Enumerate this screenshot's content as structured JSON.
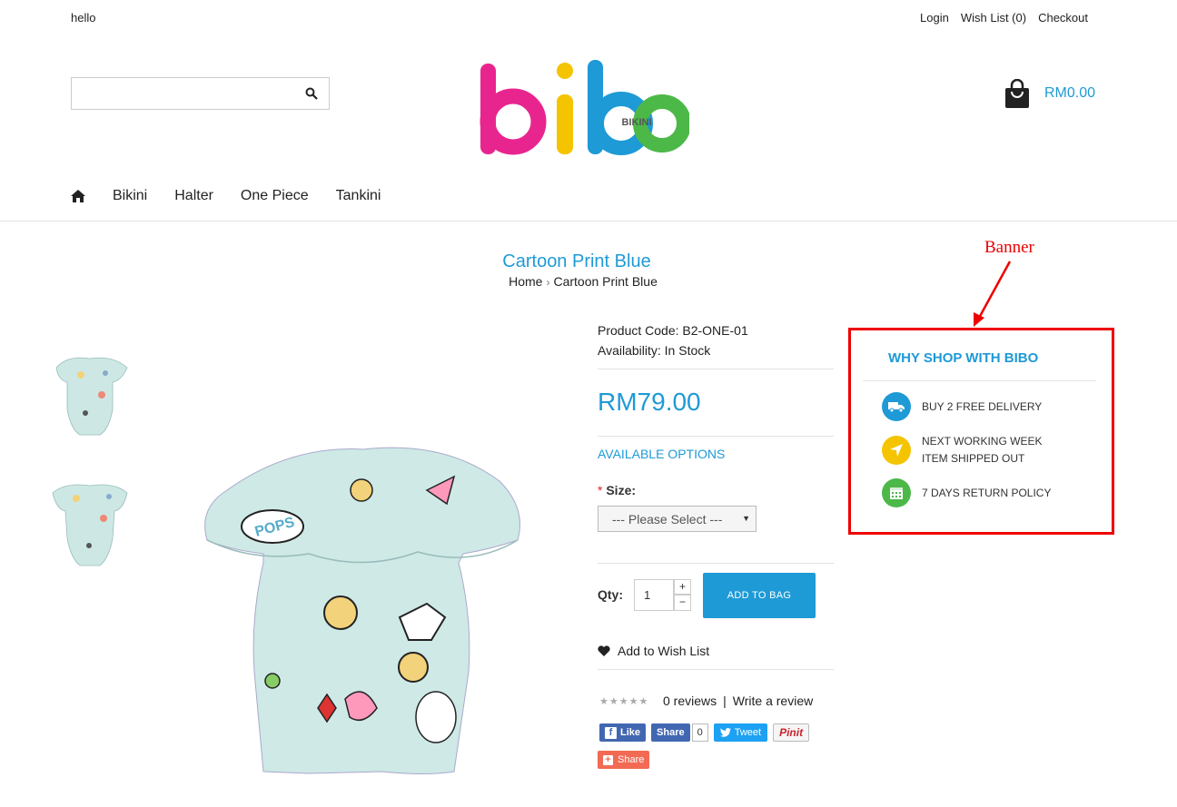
{
  "topbar": {
    "greeting": "hello",
    "links": [
      "Login",
      "Wish List (0)",
      "Checkout"
    ]
  },
  "search": {
    "placeholder": ""
  },
  "logo": {
    "text": "bibo",
    "sub": "BIKINI"
  },
  "cart": {
    "total": "RM0.00"
  },
  "nav": {
    "items": [
      "Bikini",
      "Halter",
      "One Piece",
      "Tankini"
    ]
  },
  "page": {
    "title": "Cartoon Print Blue"
  },
  "breadcrumb": {
    "home": "Home",
    "current": "Cartoon Print Blue"
  },
  "product": {
    "code_label": "Product Code: B2-ONE-01",
    "availability_label": "Availability: In Stock",
    "price": "RM79.00",
    "options_heading": "AVAILABLE OPTIONS",
    "size_required": "*",
    "size_label": "Size:",
    "size_select": "--- Please Select ---",
    "qty_label": "Qty:",
    "qty_value": "1",
    "add_to_bag": "ADD TO BAG",
    "wishlist": "Add to Wish List",
    "reviews": "0 reviews",
    "review_sep": "|",
    "write_review": "Write a review"
  },
  "social": {
    "like": "Like",
    "share": "Share",
    "share_count": "0",
    "tweet": "Tweet",
    "pinit": "Pinit",
    "addthis_share": "Share"
  },
  "annotation": {
    "label": "Banner"
  },
  "why": {
    "title": "WHY SHOP WITH BIBO",
    "items": [
      {
        "line1": "BUY 2 FREE DELIVERY",
        "line2": "",
        "color": "#1e9ad6",
        "icon": "truck-icon"
      },
      {
        "line1": "NEXT WORKING WEEK",
        "line2": "ITEM SHIPPED OUT",
        "color": "#f5c400",
        "icon": "send-arrow-icon"
      },
      {
        "line1": "7 DAYS RETURN POLICY",
        "line2": "",
        "color": "#4cb848",
        "icon": "calendar-icon"
      }
    ]
  },
  "colors": {
    "accent": "#1e9ad6",
    "annotation": "#e00000",
    "logo_pink": "#e8258f",
    "logo_yellow": "#f5c400",
    "logo_blue": "#1e9ad6",
    "logo_green": "#4cb848"
  }
}
